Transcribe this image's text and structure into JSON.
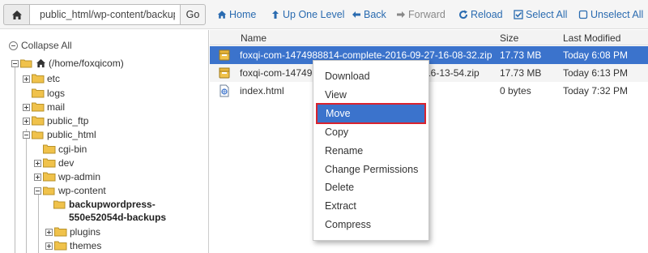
{
  "toolbar": {
    "path_value": "public_html/wp-content/backup",
    "go_label": "Go",
    "home": "Home",
    "up": "Up One Level",
    "back": "Back",
    "forward": "Forward",
    "reload": "Reload",
    "select_all": "Select All",
    "unselect_all": "Unselect All"
  },
  "tree": {
    "collapse_label": "Collapse All",
    "root": "(/home/foxqicom)",
    "items": [
      "etc",
      "logs",
      "mail",
      "public_ftp",
      "public_html",
      "cgi-bin",
      "dev",
      "wp-admin",
      "wp-content"
    ],
    "backup_folder_line1": "backupwordpress-",
    "backup_folder_line2": "550e52054d-backups",
    "sub_items": [
      "plugins",
      "themes"
    ]
  },
  "files": {
    "headers": {
      "name": "Name",
      "size": "Size",
      "modified": "Last Modified"
    },
    "rows": [
      {
        "name": "foxqi-com-1474988814-complete-2016-09-27-16-08-32.zip",
        "size": "17.73 MB",
        "modified": "Today 6:08 PM"
      },
      {
        "name_start": "foxqi-com-147498",
        "name_end": "16-13-54.zip",
        "size": "17.73 MB",
        "modified": "Today 6:13 PM"
      },
      {
        "name": "index.html",
        "size": "0 bytes",
        "modified": "Today 7:32 PM"
      }
    ]
  },
  "context_menu": {
    "items": [
      "Download",
      "View",
      "Move",
      "Copy",
      "Rename",
      "Change Permissions",
      "Delete",
      "Extract",
      "Compress"
    ],
    "highlighted": "Move"
  },
  "colors": {
    "accent_blue": "#2a6bb0",
    "selection_blue": "#3b73cc",
    "highlight_border": "#d9232e",
    "folder_yellow": "#f0c24b"
  }
}
